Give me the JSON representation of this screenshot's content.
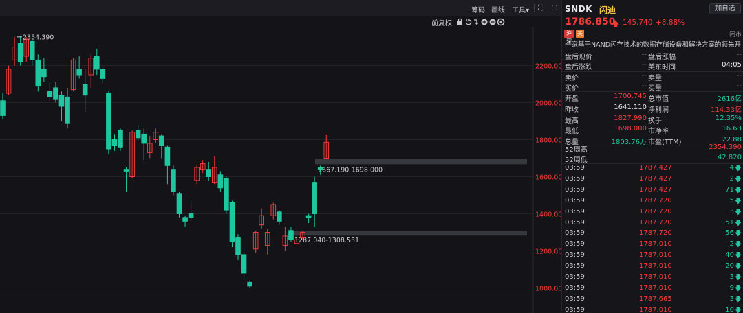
{
  "toolbar": {
    "chip_label": "筹码",
    "draw_label": "画线",
    "tools_label": "工具",
    "tools_arrow": "▾",
    "fullscreen_glyph": "⛶",
    "more_glyph": "⋮⋮",
    "adjust_label": "前复权",
    "icons": [
      "lock-icon",
      "undo-icon",
      "reset-icon",
      "zoom-in-icon",
      "zoom-out-icon",
      "settings-icon"
    ]
  },
  "chart_data": {
    "type": "candlestick",
    "y_ticks": [
      "2200.000",
      "2000.000",
      "1800.000",
      "1600.000",
      "1400.000",
      "1200.000",
      "1000.000"
    ],
    "y_tick_values": [
      2200,
      2000,
      1800,
      1600,
      1400,
      1200,
      1000
    ],
    "high_label": "2354.390",
    "high_value": 2354.39,
    "zones": [
      {
        "label": "1667.190-1698.000",
        "low": 1667.19,
        "high": 1698.0
      },
      {
        "label": "1287.040-1308.531",
        "low": 1287.04,
        "high": 1308.531
      }
    ],
    "candles": [
      [
        2010,
        1930,
        2050,
        1910
      ],
      [
        2050,
        2180,
        2200,
        2040
      ],
      [
        2230,
        2300,
        2354,
        2200
      ],
      [
        2320,
        2220,
        2360,
        2200
      ],
      [
        2250,
        2340,
        2354,
        2220
      ],
      [
        2330,
        2230,
        2350,
        2200
      ],
      [
        2230,
        2090,
        2260,
        2060
      ],
      [
        2180,
        2140,
        2240,
        2110
      ],
      [
        2060,
        2030,
        2110,
        2010
      ],
      [
        2080,
        2020,
        2110,
        2000
      ],
      [
        2040,
        1980,
        2060,
        1900
      ],
      [
        2030,
        1890,
        2080,
        1860
      ],
      [
        2070,
        2230,
        2240,
        2060
      ],
      [
        2180,
        2150,
        2250,
        2130
      ],
      [
        2100,
        2040,
        2180,
        1950
      ],
      [
        2150,
        2240,
        2260,
        2080
      ],
      [
        2250,
        2180,
        2290,
        2150
      ],
      [
        2180,
        2130,
        2190,
        2100
      ],
      [
        2050,
        1750,
        2060,
        1720
      ],
      [
        1800,
        1770,
        1830,
        1740
      ],
      [
        1850,
        1760,
        1860,
        1740
      ],
      [
        1640,
        1630,
        1650,
        1520
      ],
      [
        1600,
        1840,
        1850,
        1590
      ],
      [
        1850,
        1810,
        1880,
        1790
      ],
      [
        1830,
        1780,
        1860,
        1690
      ],
      [
        1730,
        1780,
        1820,
        1700
      ],
      [
        1800,
        1840,
        1860,
        1780
      ],
      [
        1820,
        1770,
        1830,
        1700
      ],
      [
        1760,
        1660,
        1770,
        1560
      ],
      [
        1640,
        1520,
        1660,
        1500
      ],
      [
        1510,
        1400,
        1520,
        1380
      ],
      [
        1380,
        1360,
        1390,
        1330
      ],
      [
        1400,
        1380,
        1460,
        1370
      ],
      [
        1580,
        1650,
        1660,
        1560
      ],
      [
        1640,
        1670,
        1690,
        1620
      ],
      [
        1640,
        1600,
        1680,
        1580
      ],
      [
        1570,
        1650,
        1710,
        1560
      ],
      [
        1610,
        1540,
        1630,
        1520
      ],
      [
        1590,
        1420,
        1600,
        1400
      ],
      [
        1460,
        1250,
        1470,
        1220
      ],
      [
        1270,
        1180,
        1290,
        1150
      ],
      [
        1180,
        1080,
        1220,
        1050
      ],
      [
        1030,
        1010,
        1040,
        1000
      ],
      [
        1210,
        1300,
        1310,
        1190
      ],
      [
        1340,
        1390,
        1430,
        1320
      ],
      [
        1230,
        1300,
        1320,
        1180
      ],
      [
        1390,
        1450,
        1460,
        1370
      ],
      [
        1410,
        1360,
        1420,
        1340
      ],
      [
        1230,
        1280,
        1330,
        1200
      ],
      [
        1310,
        1260,
        1330,
        1250
      ],
      [
        1240,
        1260,
        1280,
        1230
      ],
      [
        1270,
        1300,
        1310,
        1260
      ],
      [
        1390,
        1380,
        1400,
        1350
      ],
      [
        1570,
        1400,
        1600,
        1330
      ],
      [
        1650,
        1640,
        1660,
        1610
      ],
      [
        1700,
        1786,
        1828,
        1698
      ]
    ]
  },
  "quote": {
    "symbol": "SNDK",
    "name": "闪迪",
    "watch_label": "加自选",
    "price": "1786.850",
    "change": "145.740",
    "change_pct": "+8.88%",
    "badge_1": "沪深",
    "badge_2": "美",
    "market_status": "闭市",
    "description": "一家基于NAND闪存技术的数据存储设备和解决方案的领先开发...",
    "ext_rows": [
      {
        "l1": "盘后现价",
        "v1": "--",
        "l2": "盘后涨幅",
        "v2": "--"
      },
      {
        "l1": "盘后涨跌",
        "v1": "--",
        "l2": "美东时间",
        "v2": "04:05"
      }
    ],
    "book_rows": [
      {
        "l1": "卖价",
        "v1": "--",
        "l2": "卖量",
        "v2": "--"
      },
      {
        "l1": "买价",
        "v1": "--",
        "l2": "买量",
        "v2": "--"
      }
    ],
    "stat_rows": [
      {
        "l1": "开盘",
        "v1": "1700.745",
        "c1": "red",
        "l2": "总市值",
        "v2": "2616亿",
        "c2": "green"
      },
      {
        "l1": "昨收",
        "v1": "1641.110",
        "c1": "white",
        "l2": "净利润",
        "v2": "114.33亿",
        "c2": "red"
      },
      {
        "l1": "最高",
        "v1": "1827.990",
        "c1": "red",
        "l2": "换手",
        "v2": "12.35%",
        "c2": "green"
      },
      {
        "l1": "最低",
        "v1": "1698.000",
        "c1": "red",
        "l2": "市净率",
        "v2": "16.63",
        "c2": "green"
      },
      {
        "l1": "总量",
        "v1": "1803.76万",
        "c1": "green",
        "l2": "市盈(TTM)",
        "v2": "22.88",
        "c2": "green"
      }
    ],
    "week52": [
      {
        "label": "52周高",
        "value": "2354.390",
        "color": "red"
      },
      {
        "label": "52周低",
        "value": "42.820",
        "color": "green"
      }
    ]
  },
  "ticks": [
    {
      "time": "03:59",
      "price": "1787.427",
      "vol": "4"
    },
    {
      "time": "03:59",
      "price": "1787.427",
      "vol": "2"
    },
    {
      "time": "03:59",
      "price": "1787.427",
      "vol": "71"
    },
    {
      "time": "03:59",
      "price": "1787.720",
      "vol": "5"
    },
    {
      "time": "03:59",
      "price": "1787.720",
      "vol": "3"
    },
    {
      "time": "03:59",
      "price": "1787.720",
      "vol": "51"
    },
    {
      "time": "03:59",
      "price": "1787.720",
      "vol": "56"
    },
    {
      "time": "03:59",
      "price": "1787.010",
      "vol": "2"
    },
    {
      "time": "03:59",
      "price": "1787.010",
      "vol": "40"
    },
    {
      "time": "03:59",
      "price": "1787.010",
      "vol": "20"
    },
    {
      "time": "03:59",
      "price": "1787.010",
      "vol": "3"
    },
    {
      "time": "03:59",
      "price": "1787.010",
      "vol": "9"
    },
    {
      "time": "03:59",
      "price": "1787.665",
      "vol": "3"
    },
    {
      "time": "03:59",
      "price": "1787.010",
      "vol": "10"
    }
  ],
  "colors": {
    "up": "#f23a3a",
    "down": "#1fc7a0",
    "zone": "#3b3b42",
    "grid": "#222228",
    "axis_text": "#f23a3a"
  }
}
